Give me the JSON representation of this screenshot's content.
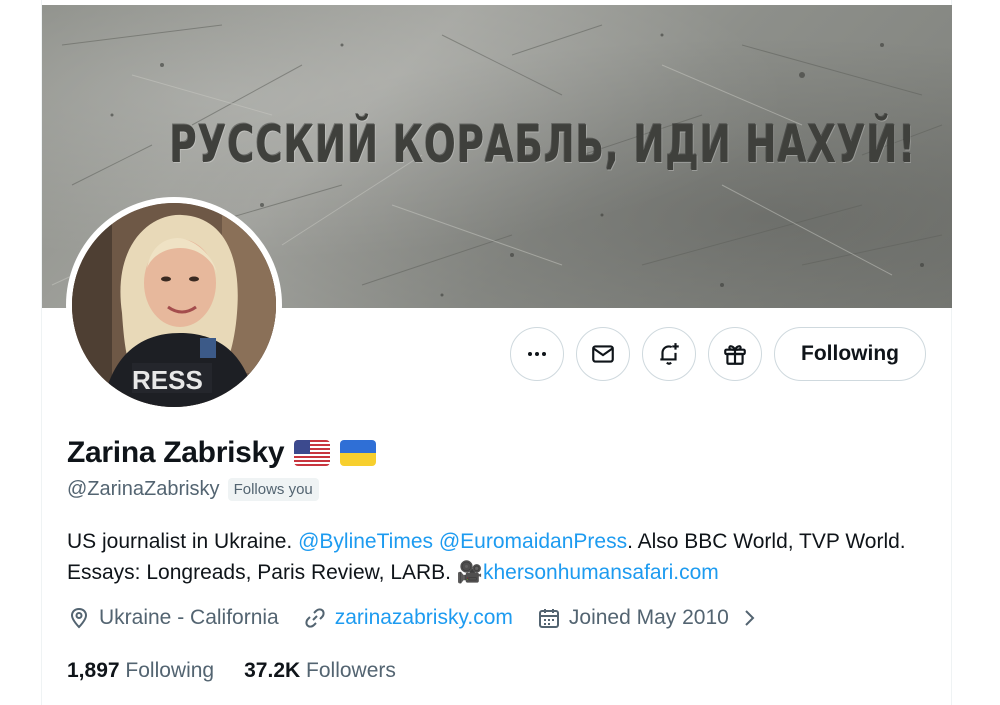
{
  "banner": {
    "text": "РУССКИЙ КОРАБЛЬ, ИДИ НАХУЙ!"
  },
  "avatar": {
    "vest_text": "RESS"
  },
  "actions": {
    "more_icon": "more-horizontal-icon",
    "message_icon": "envelope-icon",
    "notify_icon": "bell-plus-icon",
    "gift_icon": "gift-icon",
    "follow_label": "Following"
  },
  "profile": {
    "name": "Zarina Zabrisky",
    "flags": [
      "us-flag",
      "ukraine-flag"
    ],
    "handle": "@ZarinaZabrisky",
    "follows_you": "Follows you",
    "bio": {
      "part1": "US journalist in Ukraine. ",
      "mention1": "@BylineTimes",
      "space": " ",
      "mention2": "@EuromaidanPress",
      "part2": ". Also BBC World, TVP World. Essays: Longreads, Paris Review, LARB. ",
      "emoji": "🎥",
      "link": "khersonhumansafari.com"
    },
    "location": "Ukraine - California",
    "website": "zarinazabrisky.com",
    "joined": "Joined May 2010",
    "following_count": "1,897",
    "following_label": "Following",
    "followers_count": "37.2K",
    "followers_label": "Followers"
  },
  "colors": {
    "link": "#1d9bf0",
    "secondary_text": "#536471",
    "primary_text": "#0f1419",
    "border": "#cfd9de"
  }
}
